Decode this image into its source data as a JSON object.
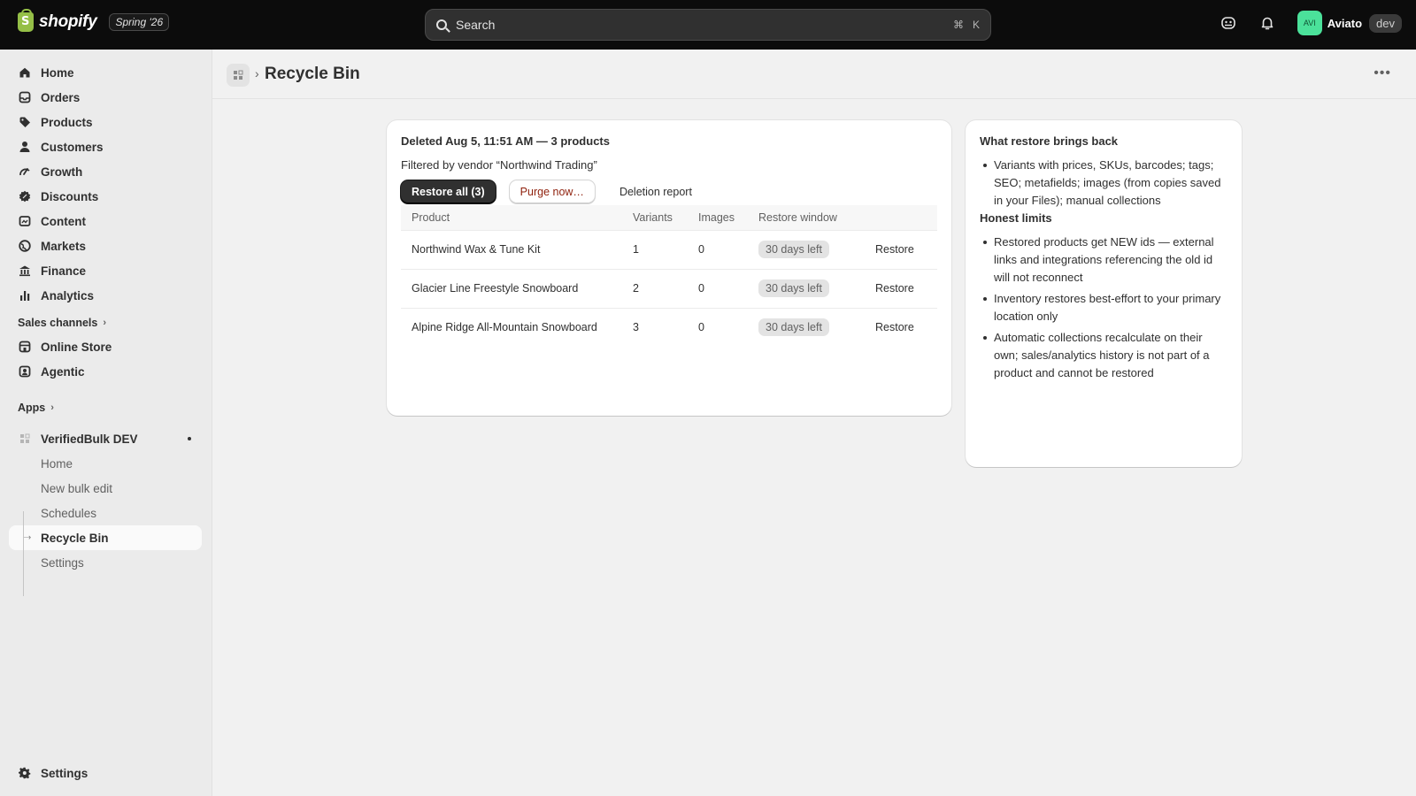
{
  "topbar": {
    "brand": "shopify",
    "edition": "Spring '26",
    "search_placeholder": "Search",
    "shortcut_cmd": "⌘",
    "shortcut_key": "K",
    "user_initials": "AVI",
    "user_name": "Aviato",
    "env_tag": "dev"
  },
  "sidebar": {
    "items": [
      {
        "label": "Home",
        "icon": "home-icon"
      },
      {
        "label": "Orders",
        "icon": "orders-icon"
      },
      {
        "label": "Products",
        "icon": "tag-icon"
      },
      {
        "label": "Customers",
        "icon": "person-icon"
      },
      {
        "label": "Growth",
        "icon": "growth-icon"
      },
      {
        "label": "Discounts",
        "icon": "discount-icon"
      },
      {
        "label": "Content",
        "icon": "content-icon"
      },
      {
        "label": "Markets",
        "icon": "globe-icon"
      },
      {
        "label": "Finance",
        "icon": "bank-icon"
      },
      {
        "label": "Analytics",
        "icon": "bar-chart-icon"
      }
    ],
    "sales_channels_label": "Sales channels",
    "channels": [
      {
        "label": "Online Store",
        "icon": "store-icon"
      },
      {
        "label": "Agentic",
        "icon": "agentic-icon"
      }
    ],
    "apps_label": "Apps",
    "app": {
      "name": "VerifiedBulk DEV",
      "subitems": [
        "Home",
        "New bulk edit",
        "Schedules",
        "Recycle Bin",
        "Settings"
      ]
    },
    "settings_label": "Settings"
  },
  "page": {
    "title": "Recycle Bin"
  },
  "batch": {
    "title": "Deleted Aug 5, 11:51 AM — 3 products",
    "filter": "Filtered by vendor “Northwind Trading”",
    "restore_all": "Restore all (3)",
    "purge": "Purge now…",
    "report": "Deletion report",
    "columns": [
      "Product",
      "Variants",
      "Images",
      "Restore window",
      ""
    ],
    "rows": [
      {
        "product": "Northwind Wax & Tune Kit",
        "variants": "1",
        "images": "0",
        "window": "30 days left",
        "action": "Restore"
      },
      {
        "product": "Glacier Line Freestyle Snowboard",
        "variants": "2",
        "images": "0",
        "window": "30 days left",
        "action": "Restore"
      },
      {
        "product": "Alpine Ridge All-Mountain Snowboard",
        "variants": "3",
        "images": "0",
        "window": "30 days left",
        "action": "Restore"
      }
    ]
  },
  "info": {
    "heading1": "What restore brings back",
    "list1": [
      "Variants with prices, SKUs, barcodes; tags; SEO; metafields; images (from copies saved in your Files); manual collections"
    ],
    "heading2": "Honest limits",
    "list2": [
      "Restored products get NEW ids — external links and integrations referencing the old id will not reconnect",
      "Inventory restores best-effort to your primary location only",
      "Automatic collections recalculate on their own; sales/analytics history is not part of a product and cannot be restored"
    ]
  },
  "colors": {
    "topbar": "#0c0c0c",
    "primary_button": "#303030",
    "purge_text": "#8e1f0b",
    "avatar": "#4be19a"
  }
}
